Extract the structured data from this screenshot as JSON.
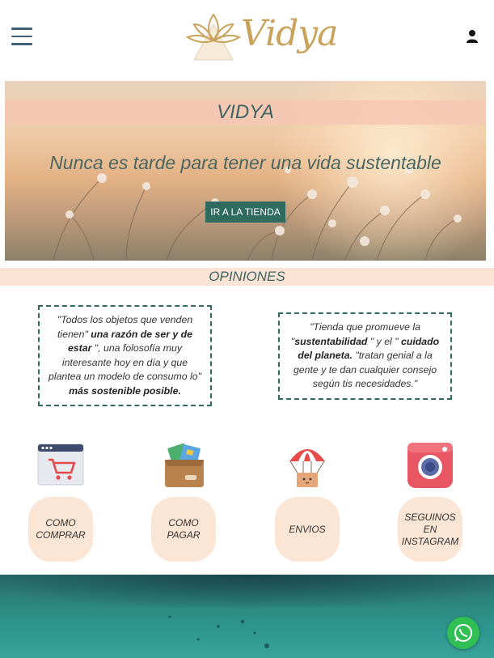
{
  "header": {
    "brand": "Vidya",
    "menu_icon": "hamburger-icon",
    "account_icon": "user-icon"
  },
  "hero": {
    "title": "VIDYA",
    "tagline": "Nunca es tarde para tener una vida sustentable",
    "cta_label": "IR A LA TIENDA"
  },
  "opinions": {
    "title": "OPINIONES",
    "reviews": [
      {
        "parts": [
          {
            "text": "\"Todos los objetos que venden tienen\" ",
            "bold": false
          },
          {
            "text": "una razón de ser y de estar",
            "bold": true
          },
          {
            "text": " \", una folosofía muy interesante hoy en día y que plantea un modelo de consumo lo\" ",
            "bold": false
          },
          {
            "text": "más sostenible posible.",
            "bold": true
          }
        ]
      },
      {
        "parts": [
          {
            "text": "\"Tienda que promueve la \"",
            "bold": false
          },
          {
            "text": "sustentabilidad",
            "bold": true
          },
          {
            "text": " \" y el \" ",
            "bold": false
          },
          {
            "text": "cuidado del planeta.",
            "bold": true
          },
          {
            "text": " \"tratan genial a la gente y te dan cualquier consejo según tis necesidades.\"",
            "bold": false
          }
        ]
      }
    ]
  },
  "info": [
    {
      "label": "COMO\nCOMPRAR",
      "icon": "shopping-cart-window-icon"
    },
    {
      "label": "COMO\nPAGAR",
      "icon": "wallet-icon"
    },
    {
      "label": "ENVIOS",
      "icon": "parachute-box-icon"
    },
    {
      "label": "SEGUINOS\nEN\nINSTAGRAM",
      "icon": "camera-icon"
    }
  ],
  "colors": {
    "accent": "#2f6b5e",
    "peach": "#fbe4d5",
    "title_text": "#3f6462",
    "logo_gold": "#c9a25c",
    "whatsapp": "#2fbf53"
  },
  "floating": {
    "whatsapp_icon": "whatsapp-icon"
  }
}
